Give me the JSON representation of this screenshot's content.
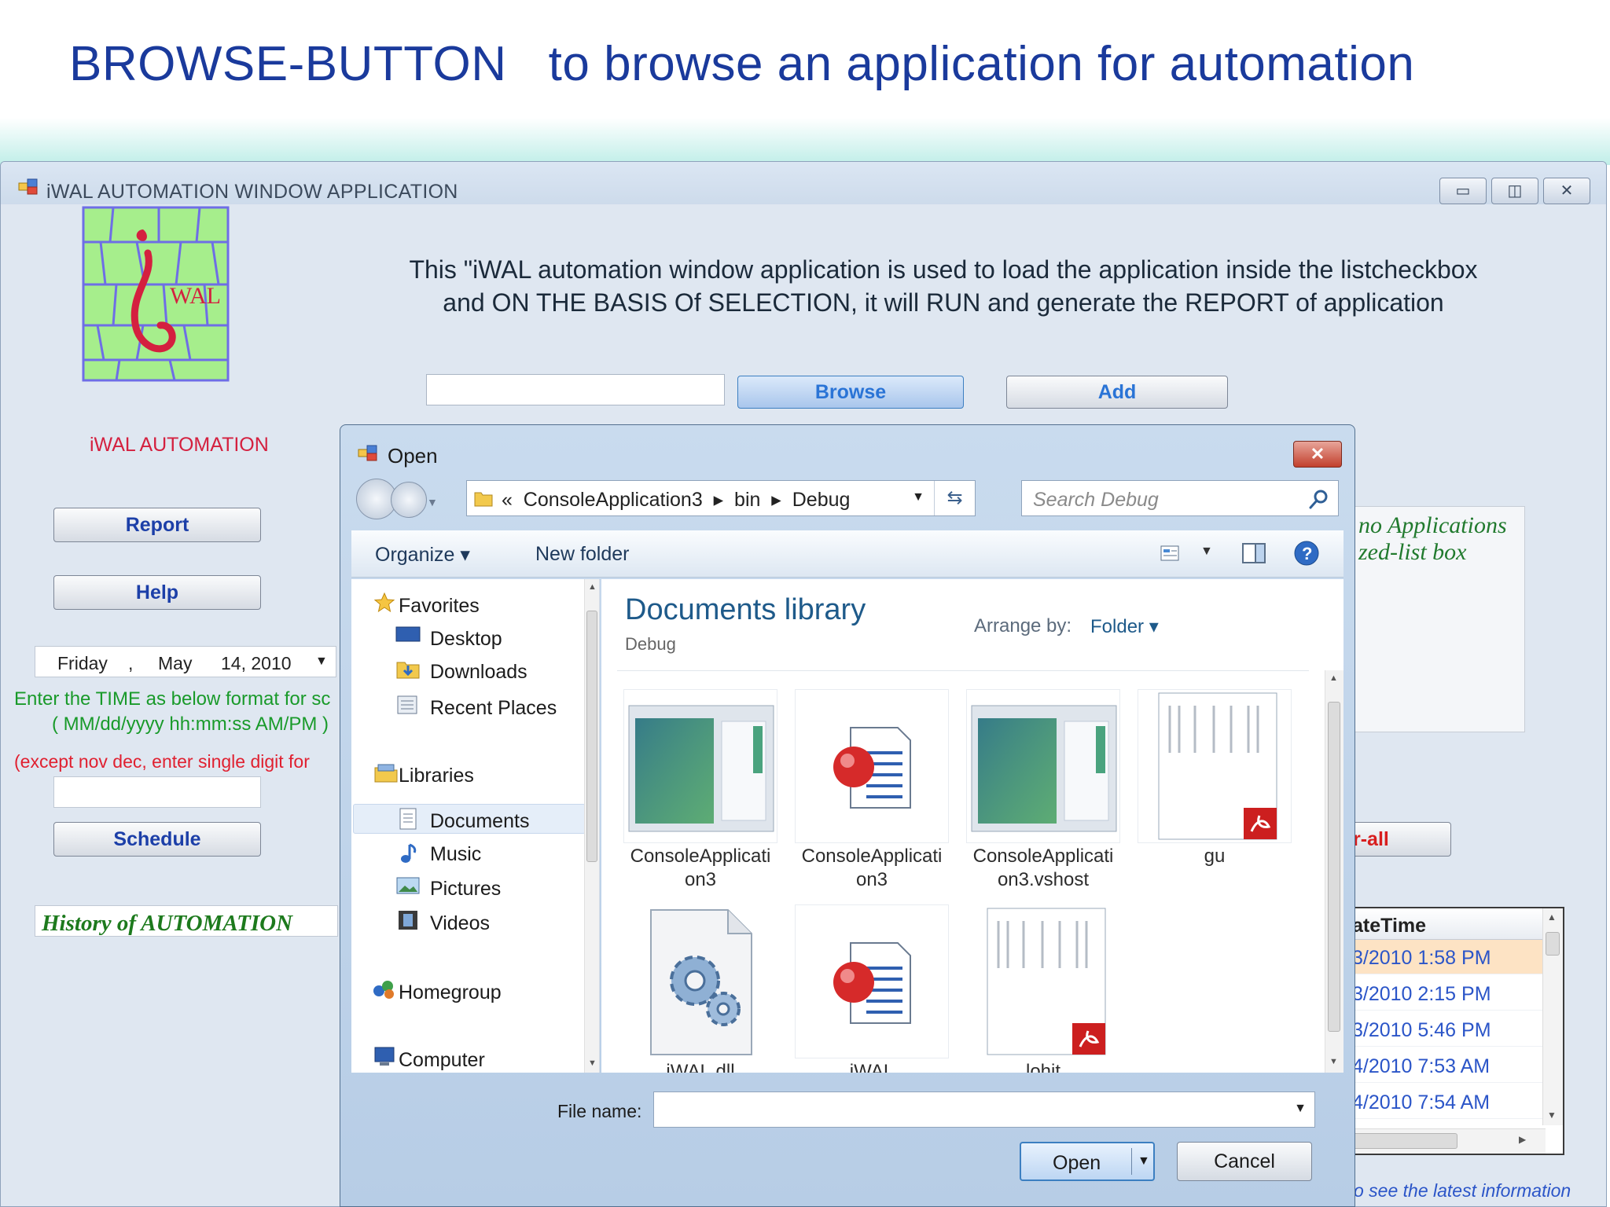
{
  "slide": {
    "title": "BROWSE-BUTTON   to browse an application for automation"
  },
  "main_window": {
    "title": "iWAL AUTOMATION WINDOW APPLICATION",
    "controls": {
      "minimize": "▭",
      "maximize": "◫",
      "close": "✕"
    },
    "logo_text": "WAL",
    "logo_caption": "iWAL AUTOMATION",
    "description_line1": "This \"iWAL automation window application is used to load the application inside the listcheckbox",
    "description_line2": "and ON THE BASIS Of SELECTION, it will RUN and generate the REPORT of application",
    "path_input_value": "",
    "buttons": {
      "browse": "Browse",
      "add": "Add",
      "report": "Report",
      "help": "Help",
      "schedule": "Schedule",
      "clear_all_partial": "r-all"
    },
    "date_picker": {
      "day": "Friday",
      "sep": ",",
      "month": "May",
      "date_year": "14, 2010"
    },
    "time_hint_1": "Enter the TIME as below format for sc",
    "time_hint_2": "( MM/dd/yyyy hh:mm:ss AM/PM )",
    "time_hint_3": "(except nov  dec, enter single digit for",
    "time_input_value": "",
    "history_label": "History of AUTOMATION",
    "listbox_line1": "no Applications",
    "listbox_line2": "zed-list box",
    "grid_header": "ateTime",
    "grid_rows": [
      "3/2010 1:58 PM",
      "3/2010 2:15 PM",
      "3/2010 5:46 PM",
      "4/2010 7:53 AM",
      "4/2010 7:54 AM"
    ],
    "footer_hint": "o see the latest information"
  },
  "open_dialog": {
    "title": "Open",
    "close_label": "✕",
    "address": "«  ConsoleApplication3  ▸  bin  ▸  Debug",
    "search_placeholder": "Search Debug",
    "toolbar": {
      "organize": "Organize ▾",
      "new_folder": "New folder"
    },
    "nav": {
      "favorites": "Favorites",
      "desktop": "Desktop",
      "downloads": "Downloads",
      "recent_places": "Recent Places",
      "libraries": "Libraries",
      "documents": "Documents",
      "music": "Music",
      "pictures": "Pictures",
      "videos": "Videos",
      "homegroup": "Homegroup",
      "computer": "Computer"
    },
    "library_title": "Documents library",
    "library_subtitle": "Debug",
    "arrange_label": "Arrange by:",
    "arrange_value": "Folder ▾",
    "files": [
      {
        "name": "ConsoleApplicati\non3",
        "icon": "window-app-icon"
      },
      {
        "name": "ConsoleApplicati\non3",
        "icon": "red-document-icon"
      },
      {
        "name": "ConsoleApplicati\non3.vshost",
        "icon": "window-app-icon"
      },
      {
        "name": "gu",
        "icon": "pdf-document-icon"
      },
      {
        "name": "iWAL.dll",
        "icon": "gear-file-icon"
      },
      {
        "name": "iWAL",
        "icon": "red-document-icon"
      },
      {
        "name": "lohit",
        "icon": "pdf-document-icon"
      }
    ],
    "filename_label": "File name:",
    "filename_value": "",
    "open_button": "Open",
    "cancel_button": "Cancel"
  }
}
